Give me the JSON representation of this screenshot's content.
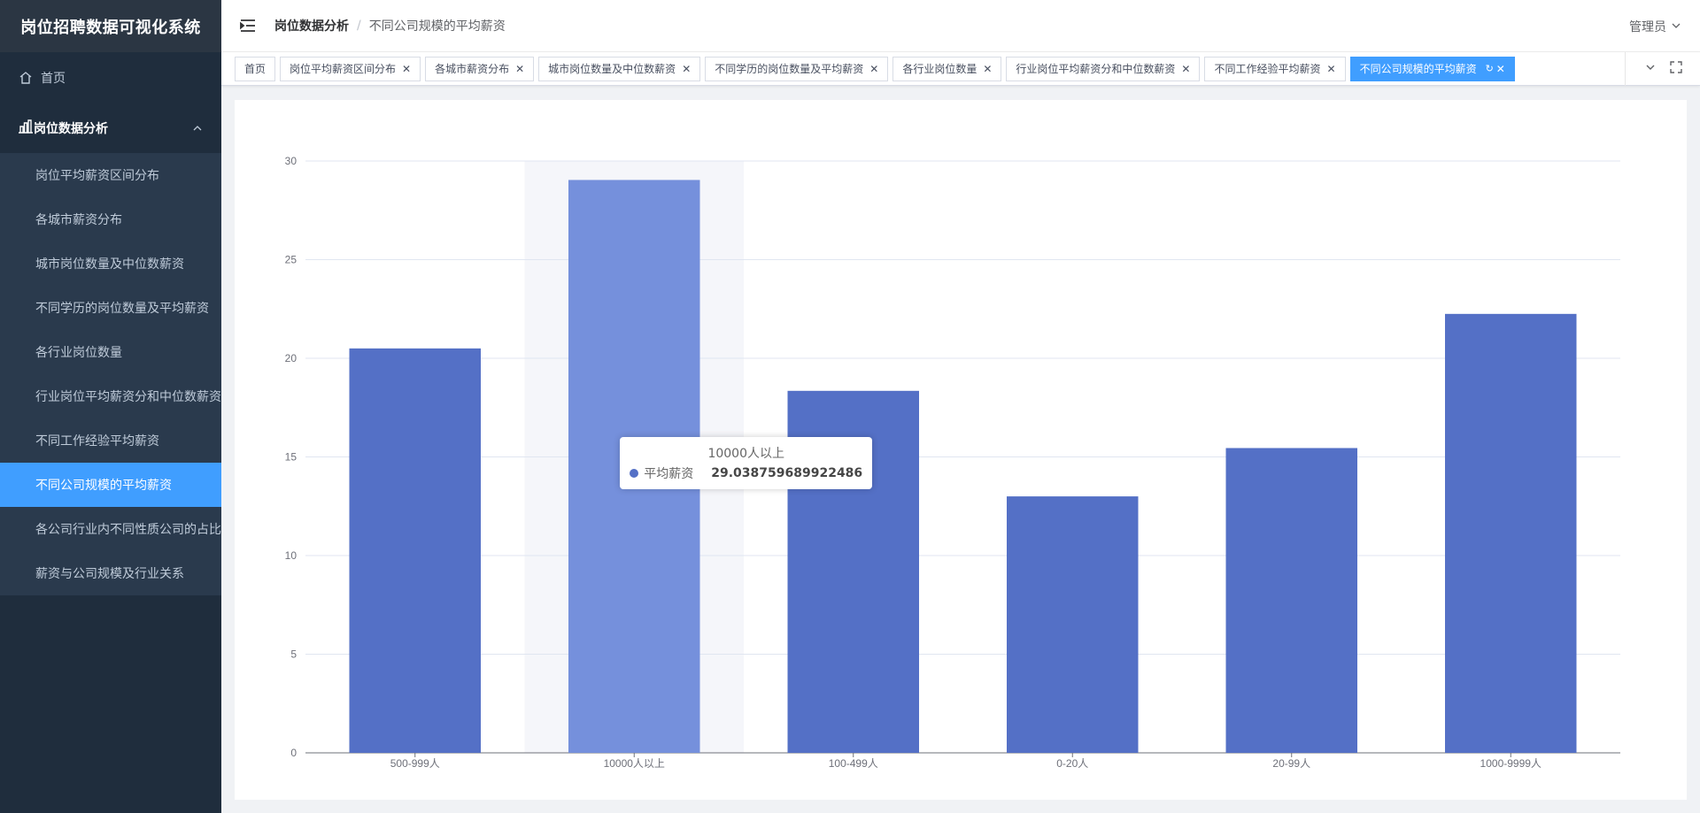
{
  "app": {
    "title": "岗位招聘数据可视化系统"
  },
  "sidebar": {
    "home": "首页",
    "group": "岗位数据分析",
    "items": [
      "岗位平均薪资区间分布",
      "各城市薪资分布",
      "城市岗位数量及中位数薪资",
      "不同学历的岗位数量及平均薪资",
      "各行业岗位数量",
      "行业岗位平均薪资分和中位数薪资",
      "不同工作经验平均薪资",
      "不同公司规模的平均薪资",
      "各公司行业内不同性质公司的占比",
      "薪资与公司规模及行业关系"
    ],
    "active_index": 7
  },
  "navbar": {
    "breadcrumb": [
      "岗位数据分析",
      "不同公司规模的平均薪资"
    ],
    "separator": "/",
    "user": "管理员"
  },
  "tags": {
    "items": [
      {
        "label": "首页",
        "closable": false
      },
      {
        "label": "岗位平均薪资区间分布",
        "closable": true
      },
      {
        "label": "各城市薪资分布",
        "closable": true
      },
      {
        "label": "城市岗位数量及中位数薪资",
        "closable": true
      },
      {
        "label": "不同学历的岗位数量及平均薪资",
        "closable": true
      },
      {
        "label": "各行业岗位数量",
        "closable": true
      },
      {
        "label": "行业岗位平均薪资分和中位数薪资",
        "closable": true
      },
      {
        "label": "不同工作经验平均薪资",
        "closable": true
      },
      {
        "label": "不同公司规模的平均薪资",
        "closable": true,
        "active": true
      }
    ]
  },
  "chart_data": {
    "type": "bar",
    "categories": [
      "500-999人",
      "10000人以上",
      "100-499人",
      "0-20人",
      "20-99人",
      "1000-9999人"
    ],
    "series": [
      {
        "name": "平均薪资",
        "values": [
          20.5,
          29.038759689922486,
          18.35,
          13.0,
          15.45,
          22.25
        ]
      }
    ],
    "ylim": [
      0,
      30
    ],
    "yticks": [
      0,
      5,
      10,
      15,
      20,
      25,
      30
    ],
    "grid": true,
    "color": "#5470c6",
    "highlight_color": "#7590dc",
    "highlight_index": 1,
    "tooltip": {
      "title": "10000人以上",
      "series": "平均薪资",
      "value": "29.038759689922486"
    }
  }
}
